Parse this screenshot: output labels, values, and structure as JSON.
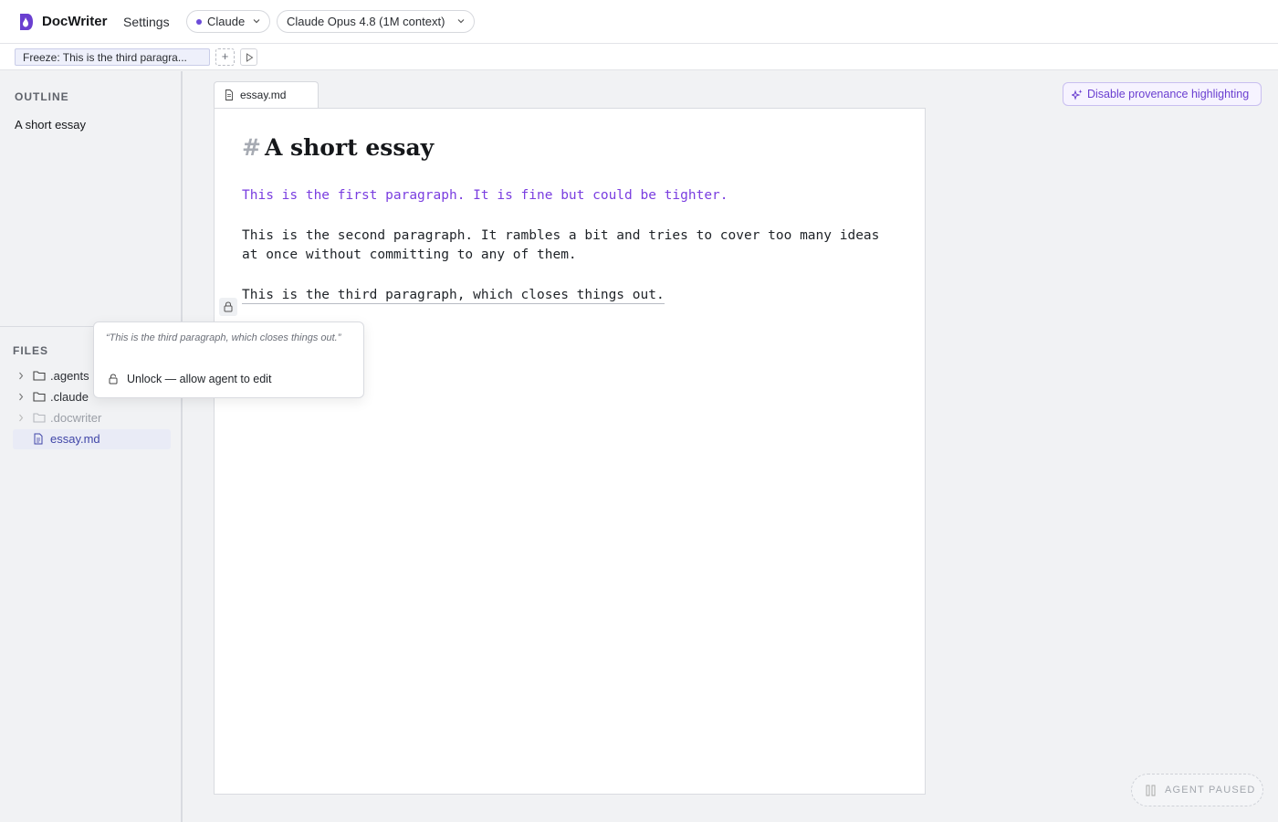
{
  "app": {
    "title": "DocWriter",
    "settings_label": "Settings",
    "provider": "Claude",
    "model": "Claude Opus 4.8 (1M context)",
    "accent_color": "#6a3fd0"
  },
  "toolbar": {
    "freeze_chip": "Freeze: This is the third paragra...",
    "add_label": "+",
    "run_icon": "play-icon"
  },
  "sidebar": {
    "outline_label": "OUTLINE",
    "outline_items": [
      {
        "label": "A short essay"
      }
    ],
    "files_label": "FILES",
    "files": [
      {
        "name": ".agents",
        "type": "folder",
        "icon": "folder-icon"
      },
      {
        "name": ".claude",
        "type": "folder",
        "icon": "folder-icon"
      },
      {
        "name": ".docwriter",
        "type": "folder",
        "icon": "folder-icon",
        "dimmed": true
      },
      {
        "name": "essay.md",
        "type": "file",
        "icon": "file-icon",
        "selected": true
      }
    ]
  },
  "editor": {
    "tab_label": "essay.md",
    "provenance_button": "Disable provenance highlighting",
    "heading_marker": "#",
    "heading": "A short essay",
    "paragraphs": [
      {
        "text": "This is the first paragraph. It is fine but could be tighter.",
        "provenance": "agent",
        "color": "#7a3ee0"
      },
      {
        "text": "This is the second paragraph. It rambles a bit and tries to cover too many ideas at once without committing to any of them.",
        "provenance": "human"
      },
      {
        "text": "This is the third paragraph, which closes things out.",
        "provenance": "human",
        "frozen": true
      }
    ]
  },
  "popover": {
    "quote": "“This is the third paragraph, which closes things out.”",
    "action": "Unlock — allow agent to edit"
  },
  "agent_status": {
    "label": "AGENT PAUSED",
    "icon": "pause-icon"
  }
}
